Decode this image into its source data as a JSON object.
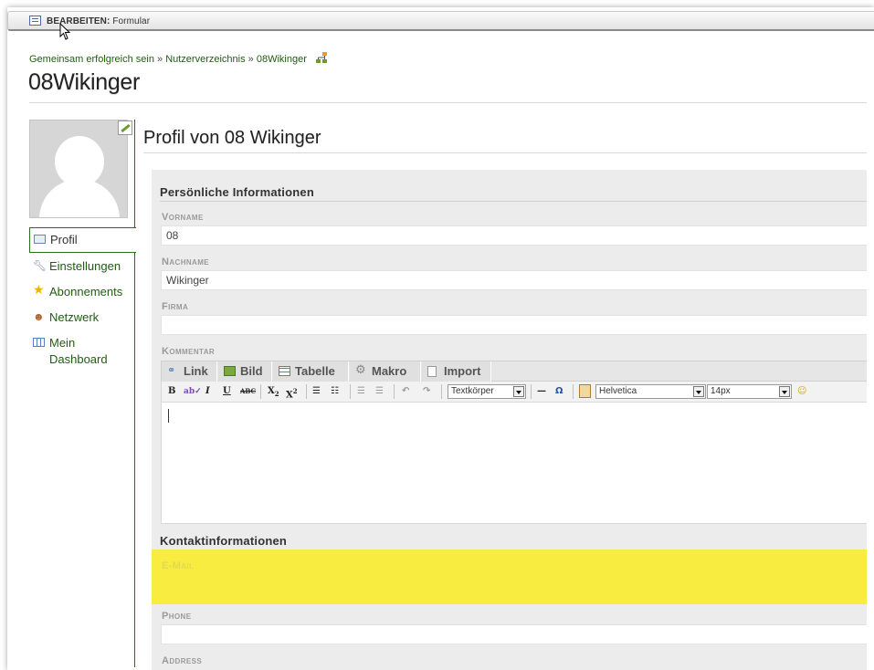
{
  "actionbar": {
    "strong": "BEARBEITEN:",
    "rest": " Formular"
  },
  "breadcrumb": {
    "items": [
      "Gemeinsam erfolgreich sein",
      "Nutzerverzeichnis",
      "08Wikinger"
    ],
    "separator": " » "
  },
  "page_title": "08Wikinger",
  "content_title": "Profil von 08 Wikinger",
  "sidebar": {
    "items": [
      {
        "label": "Profil",
        "icon": "profile-card-icon",
        "active": true
      },
      {
        "label": "Einstellungen",
        "icon": "wrench-icon"
      },
      {
        "label": "Abonnements",
        "icon": "star-icon"
      },
      {
        "label": "Netzwerk",
        "icon": "network-icon"
      },
      {
        "label": "Mein Dashboard",
        "icon": "dashboard-icon"
      }
    ]
  },
  "personal": {
    "heading": "Persönliche Informationen",
    "fields": [
      {
        "label": "Vorname",
        "value": "08"
      },
      {
        "label": "Nachname",
        "value": "Wikinger"
      },
      {
        "label": "Firma",
        "value": ""
      },
      {
        "label": "Kommentar",
        "value": ""
      }
    ]
  },
  "editor": {
    "tabs": [
      "Link",
      "Bild",
      "Tabelle",
      "Makro",
      "Import"
    ],
    "style_select": "Textkörper",
    "font_select": "Helvetica",
    "size_select": "14px"
  },
  "contact": {
    "heading": "Kontaktinformationen",
    "fields": [
      {
        "label": "E-Mail",
        "value": "",
        "highlight_color": "#f8ec40"
      },
      {
        "label": "Phone",
        "value": ""
      },
      {
        "label": "Address",
        "value": ""
      }
    ]
  },
  "colors": {
    "link": "#1f5d10",
    "accent_border": "#2d6e1a",
    "highlight": "#f8ec40"
  }
}
